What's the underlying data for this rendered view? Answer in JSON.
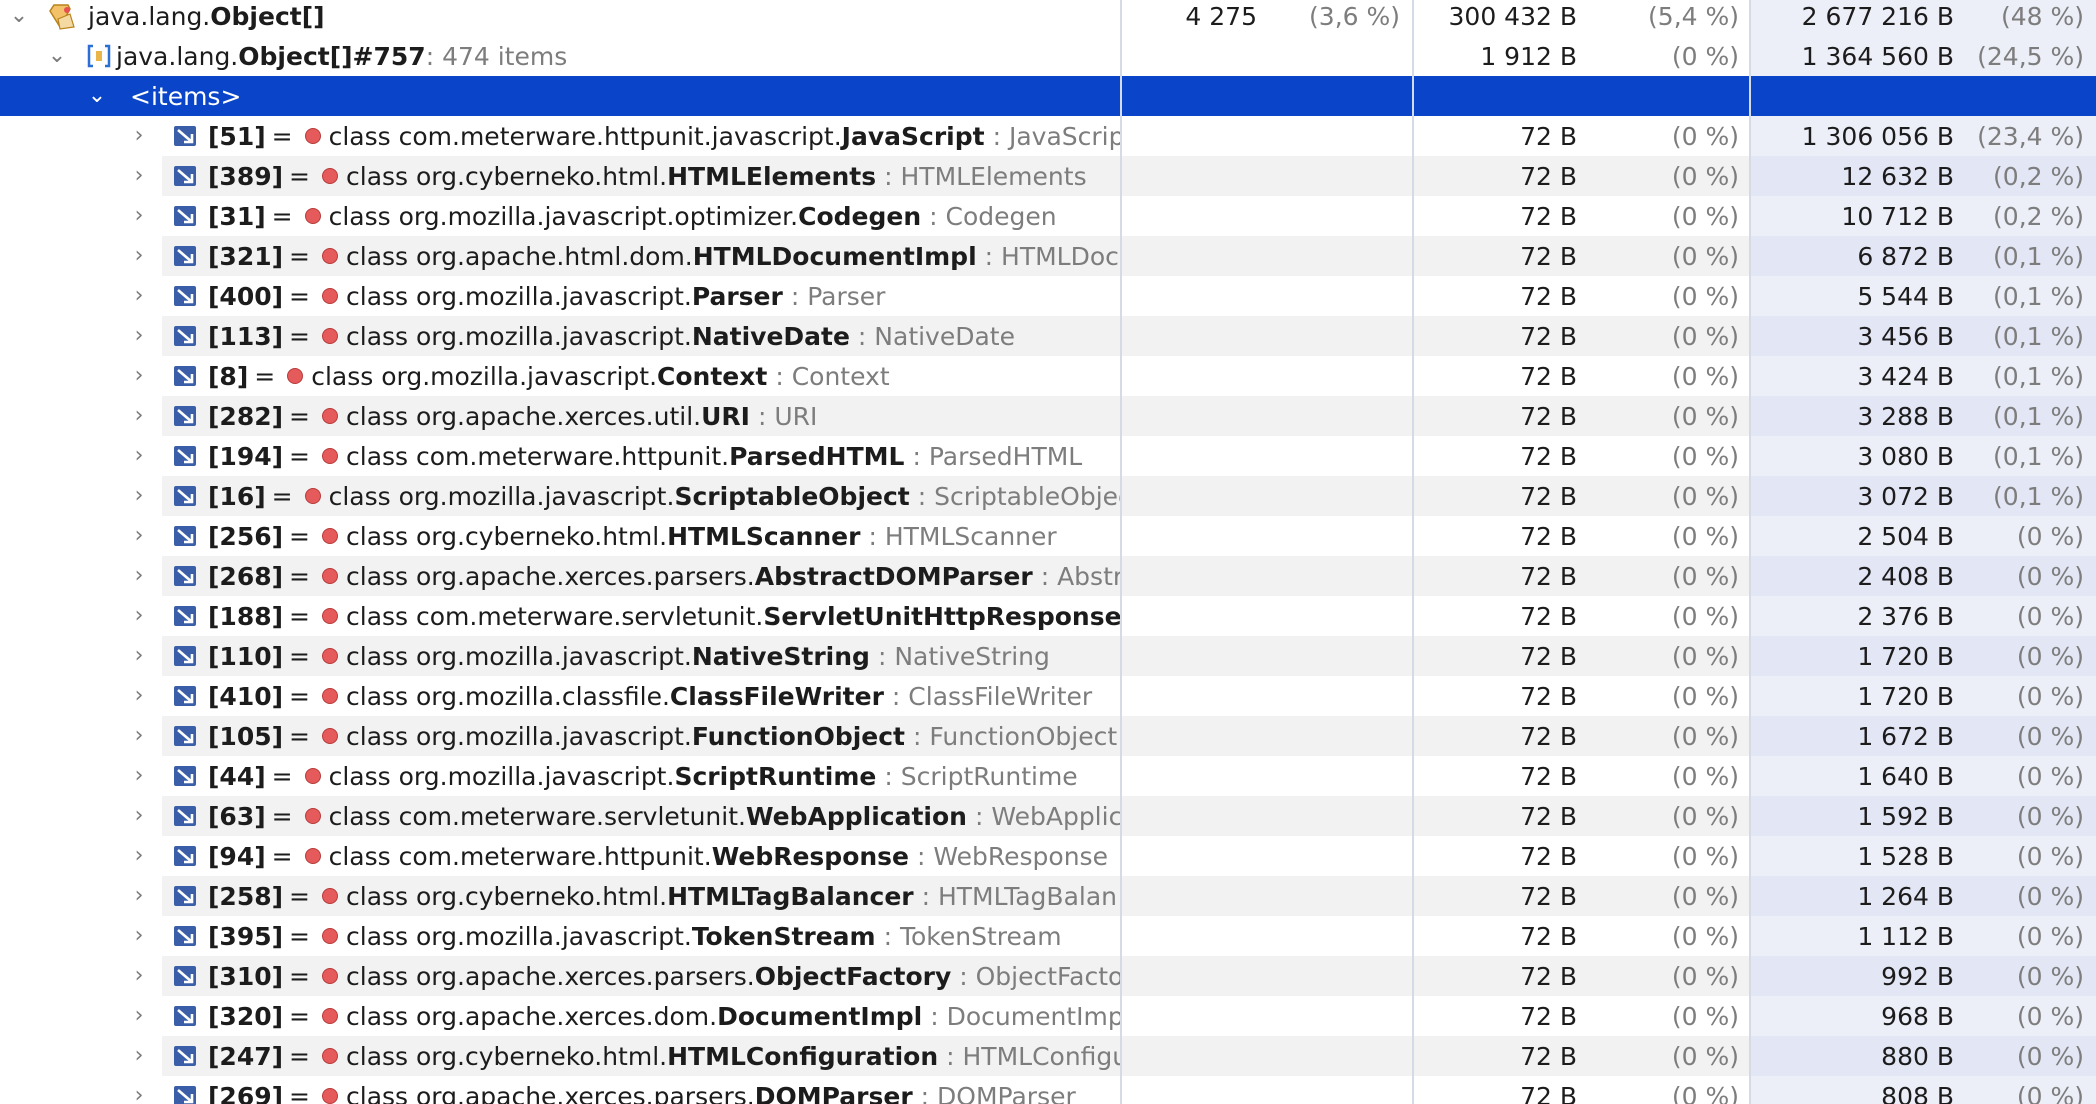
{
  "header_rows": {
    "root": {
      "label_prefix": "java.lang.",
      "label_bold": "Object[]",
      "count": "4 275",
      "count_pct": "(3,6 %)",
      "shallow": "300 432 B",
      "shallow_pct": "(5,4 %)",
      "retained": "2 677 216 B",
      "retained_pct": "(48 %)",
      "icon": "object-class-icon"
    },
    "instance": {
      "label_prefix": "java.lang.",
      "label_bold": "Object[]#757",
      "label_suffix": " : 474 items",
      "shallow": "1 912 B",
      "shallow_pct": "(0 %)",
      "retained": "1 364 560 B",
      "retained_pct": "(24,5 %)",
      "icon": "array-instance-icon"
    },
    "items_node": {
      "label": "<items>"
    }
  },
  "items": [
    {
      "index": "[51]",
      "pkg": "class com.meterware.httpunit.javascript.",
      "cls": "JavaScript",
      "type": ": JavaScript",
      "shallow": "72 B",
      "shallow_pct": "(0 %)",
      "retained": "1 306 056 B",
      "retained_pct": "(23,4 %)"
    },
    {
      "index": "[389]",
      "pkg": "class org.cyberneko.html.",
      "cls": "HTMLElements",
      "type": ": HTMLElements",
      "shallow": "72 B",
      "shallow_pct": "(0 %)",
      "retained": "12 632 B",
      "retained_pct": "(0,2 %)"
    },
    {
      "index": "[31]",
      "pkg": "class org.mozilla.javascript.optimizer.",
      "cls": "Codegen",
      "type": ": Codegen",
      "shallow": "72 B",
      "shallow_pct": "(0 %)",
      "retained": "10 712 B",
      "retained_pct": "(0,2 %)"
    },
    {
      "index": "[321]",
      "pkg": "class org.apache.html.dom.",
      "cls": "HTMLDocumentImpl",
      "type": ": HTMLDocu",
      "shallow": "72 B",
      "shallow_pct": "(0 %)",
      "retained": "6 872 B",
      "retained_pct": "(0,1 %)"
    },
    {
      "index": "[400]",
      "pkg": "class org.mozilla.javascript.",
      "cls": "Parser",
      "type": ": Parser",
      "shallow": "72 B",
      "shallow_pct": "(0 %)",
      "retained": "5 544 B",
      "retained_pct": "(0,1 %)"
    },
    {
      "index": "[113]",
      "pkg": "class org.mozilla.javascript.",
      "cls": "NativeDate",
      "type": ": NativeDate",
      "shallow": "72 B",
      "shallow_pct": "(0 %)",
      "retained": "3 456 B",
      "retained_pct": "(0,1 %)"
    },
    {
      "index": "[8]",
      "pkg": "class org.mozilla.javascript.",
      "cls": "Context",
      "type": ": Context",
      "shallow": "72 B",
      "shallow_pct": "(0 %)",
      "retained": "3 424 B",
      "retained_pct": "(0,1 %)"
    },
    {
      "index": "[282]",
      "pkg": "class org.apache.xerces.util.",
      "cls": "URI",
      "type": ": URI",
      "shallow": "72 B",
      "shallow_pct": "(0 %)",
      "retained": "3 288 B",
      "retained_pct": "(0,1 %)"
    },
    {
      "index": "[194]",
      "pkg": "class com.meterware.httpunit.",
      "cls": "ParsedHTML",
      "type": ": ParsedHTML",
      "shallow": "72 B",
      "shallow_pct": "(0 %)",
      "retained": "3 080 B",
      "retained_pct": "(0,1 %)"
    },
    {
      "index": "[16]",
      "pkg": "class org.mozilla.javascript.",
      "cls": "ScriptableObject",
      "type": ": ScriptableObjec",
      "shallow": "72 B",
      "shallow_pct": "(0 %)",
      "retained": "3 072 B",
      "retained_pct": "(0,1 %)"
    },
    {
      "index": "[256]",
      "pkg": "class org.cyberneko.html.",
      "cls": "HTMLScanner",
      "type": ": HTMLScanner",
      "shallow": "72 B",
      "shallow_pct": "(0 %)",
      "retained": "2 504 B",
      "retained_pct": "(0 %)"
    },
    {
      "index": "[268]",
      "pkg": "class org.apache.xerces.parsers.",
      "cls": "AbstractDOMParser",
      "type": ": Abstra",
      "shallow": "72 B",
      "shallow_pct": "(0 %)",
      "retained": "2 408 B",
      "retained_pct": "(0 %)"
    },
    {
      "index": "[188]",
      "pkg": "class com.meterware.servletunit.",
      "cls": "ServletUnitHttpResponse",
      "type": ":",
      "shallow": "72 B",
      "shallow_pct": "(0 %)",
      "retained": "2 376 B",
      "retained_pct": "(0 %)"
    },
    {
      "index": "[110]",
      "pkg": "class org.mozilla.javascript.",
      "cls": "NativeString",
      "type": ": NativeString",
      "shallow": "72 B",
      "shallow_pct": "(0 %)",
      "retained": "1 720 B",
      "retained_pct": "(0 %)"
    },
    {
      "index": "[410]",
      "pkg": "class org.mozilla.classfile.",
      "cls": "ClassFileWriter",
      "type": ": ClassFileWriter",
      "shallow": "72 B",
      "shallow_pct": "(0 %)",
      "retained": "1 720 B",
      "retained_pct": "(0 %)"
    },
    {
      "index": "[105]",
      "pkg": "class org.mozilla.javascript.",
      "cls": "FunctionObject",
      "type": ": FunctionObject",
      "shallow": "72 B",
      "shallow_pct": "(0 %)",
      "retained": "1 672 B",
      "retained_pct": "(0 %)"
    },
    {
      "index": "[44]",
      "pkg": "class org.mozilla.javascript.",
      "cls": "ScriptRuntime",
      "type": ": ScriptRuntime",
      "shallow": "72 B",
      "shallow_pct": "(0 %)",
      "retained": "1 640 B",
      "retained_pct": "(0 %)"
    },
    {
      "index": "[63]",
      "pkg": "class com.meterware.servletunit.",
      "cls": "WebApplication",
      "type": ": WebApplica",
      "shallow": "72 B",
      "shallow_pct": "(0 %)",
      "retained": "1 592 B",
      "retained_pct": "(0 %)"
    },
    {
      "index": "[94]",
      "pkg": "class com.meterware.httpunit.",
      "cls": "WebResponse",
      "type": ": WebResponse",
      "shallow": "72 B",
      "shallow_pct": "(0 %)",
      "retained": "1 528 B",
      "retained_pct": "(0 %)"
    },
    {
      "index": "[258]",
      "pkg": "class org.cyberneko.html.",
      "cls": "HTMLTagBalancer",
      "type": ": HTMLTagBalan",
      "shallow": "72 B",
      "shallow_pct": "(0 %)",
      "retained": "1 264 B",
      "retained_pct": "(0 %)"
    },
    {
      "index": "[395]",
      "pkg": "class org.mozilla.javascript.",
      "cls": "TokenStream",
      "type": ": TokenStream",
      "shallow": "72 B",
      "shallow_pct": "(0 %)",
      "retained": "1 112 B",
      "retained_pct": "(0 %)"
    },
    {
      "index": "[310]",
      "pkg": "class org.apache.xerces.parsers.",
      "cls": "ObjectFactory",
      "type": ": ObjectFactor",
      "shallow": "72 B",
      "shallow_pct": "(0 %)",
      "retained": "992 B",
      "retained_pct": "(0 %)"
    },
    {
      "index": "[320]",
      "pkg": "class org.apache.xerces.dom.",
      "cls": "DocumentImpl",
      "type": ": DocumentImpl",
      "shallow": "72 B",
      "shallow_pct": "(0 %)",
      "retained": "968 B",
      "retained_pct": "(0 %)"
    },
    {
      "index": "[247]",
      "pkg": "class org.cyberneko.html.",
      "cls": "HTMLConfiguration",
      "type": ": HTMLConfigu",
      "shallow": "72 B",
      "shallow_pct": "(0 %)",
      "retained": "880 B",
      "retained_pct": "(0 %)"
    },
    {
      "index": "[269]",
      "pkg": "class org.apache.xerces.parsers.",
      "cls": "DOMParser",
      "type": ": DOMParser",
      "shallow": "72 B",
      "shallow_pct": "(0 %)",
      "retained": "808 B",
      "retained_pct": "(0 %)"
    }
  ],
  "labels": {
    "equals": "="
  },
  "colors": {
    "selection": "#0a45c9",
    "alt_row": "#f2f2f2",
    "retained_column": "#eceef8",
    "class_dot": "#e55a5a"
  }
}
